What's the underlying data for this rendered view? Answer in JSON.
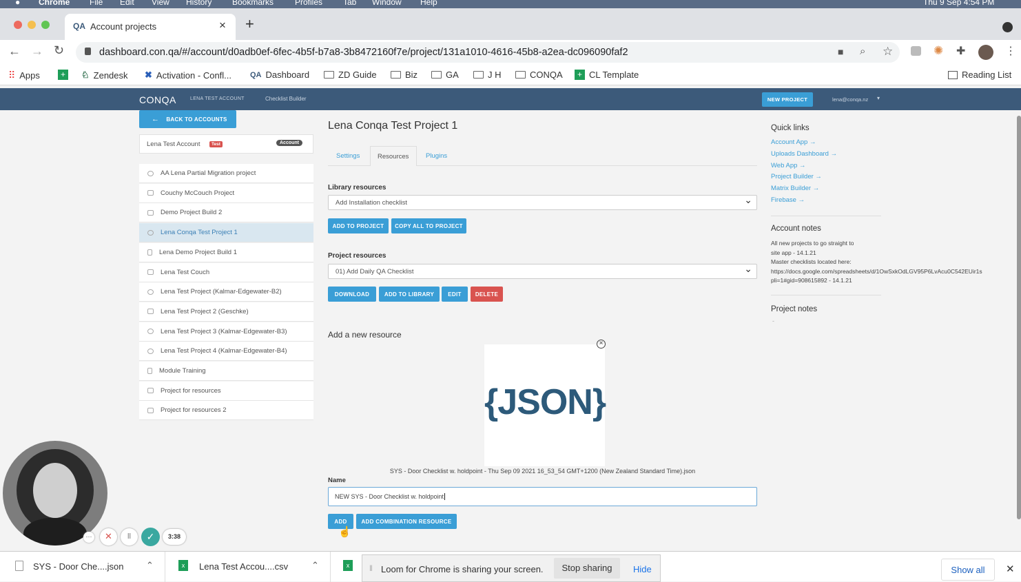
{
  "menubar": {
    "items": [
      "Chrome",
      "File",
      "Edit",
      "View",
      "History",
      "Bookmarks",
      "Profiles",
      "Tab",
      "Window",
      "Help"
    ],
    "clock": "Thu 9 Sep  4:54 PM"
  },
  "browser": {
    "tab_title": "Account projects",
    "tab_favicon": "QA",
    "url": "dashboard.con.qa/#/account/d0adb0ef-6fec-4b5f-b7a8-3b8472160f7e/project/131a1010-4616-45b8-a2ea-dc096090faf2",
    "bookmarks": [
      "Apps",
      "Zendesk",
      "Activation - Confl...",
      "Dashboard",
      "ZD Guide",
      "Biz",
      "GA",
      "J H",
      "CONQA",
      "CL Template"
    ],
    "reading_list": "Reading List"
  },
  "header": {
    "logo": "CONQA",
    "account": "LENA TEST ACCOUNT",
    "checklist_builder": "Checklist Builder",
    "new_project": "NEW PROJECT",
    "user": "lena@conqa.nz"
  },
  "sidebar": {
    "back": "BACK TO ACCOUNTS",
    "account_name": "Lena Test Account",
    "test_badge": "Test",
    "account_badge": "Account",
    "projects": [
      "AA Lena Partial Migration project",
      "Couchy McCouch Project",
      "Demo Project Build 2",
      "Lena Conqa Test Project 1",
      "Lena Demo Project Build 1",
      "Lena Test Couch",
      "Lena Test Project (Kalmar-Edgewater-B2)",
      "Lena Test Project 2 (Geschke)",
      "Lena Test Project 3 (Kalmar-Edgewater-B3)",
      "Lena Test Project 4 (Kalmar-Edgewater-B4)",
      "Module Training",
      "Project for resources",
      "Project for resources 2"
    ]
  },
  "main": {
    "title": "Lena Conqa Test Project 1",
    "tabs": [
      "Settings",
      "Resources",
      "Plugins"
    ],
    "library_label": "Library resources",
    "library_select": "Add Installation checklist",
    "add_to_project": "ADD TO PROJECT",
    "copy_all": "COPY ALL TO PROJECT",
    "project_label": "Project resources",
    "project_select": "01) Add Daily QA Checklist",
    "download": "DOWNLOAD",
    "add_to_library": "ADD TO LIBRARY",
    "edit": "EDIT",
    "delete": "DELETE",
    "new_resource_heading": "Add a new resource",
    "json_image_text": "{JSON}",
    "file_name": "SYS - Door Checklist w. holdpoint - Thu Sep 09 2021 16_53_54 GMT+1200 (New Zealand Standard Time).json",
    "name_label": "Name",
    "name_value": "NEW SYS - Door Checklist w. holdpoint",
    "add": "ADD",
    "add_combination": "ADD COMBINATION RESOURCE"
  },
  "right": {
    "quick_links_title": "Quick links",
    "quick_links": [
      "Account App →",
      "Uploads Dashboard →",
      "Web App →",
      "Project Builder →",
      "Matrix Builder →",
      "Firebase →"
    ],
    "account_notes_title": "Account notes",
    "account_notes": [
      "All new projects to go straight to",
      "site app - 14.1.21",
      "Master checklists located here:",
      "https://docs.google.com/spreadsheets/d/1OwSxkOdLGV95P6LvAcu0C542EUir1s",
      "pli=1#gid=908615892 - 14.1.21"
    ],
    "project_notes_title": "Project notes",
    "project_notes_value": "-"
  },
  "recorder": {
    "timer": "3:38"
  },
  "downloads": {
    "file1": "SYS - Door Che....json",
    "file2": "Lena Test Accou....csv",
    "sharing_msg": "Loom for Chrome is sharing your screen.",
    "stop": "Stop sharing",
    "hide": "Hide",
    "show_all": "Show all"
  }
}
